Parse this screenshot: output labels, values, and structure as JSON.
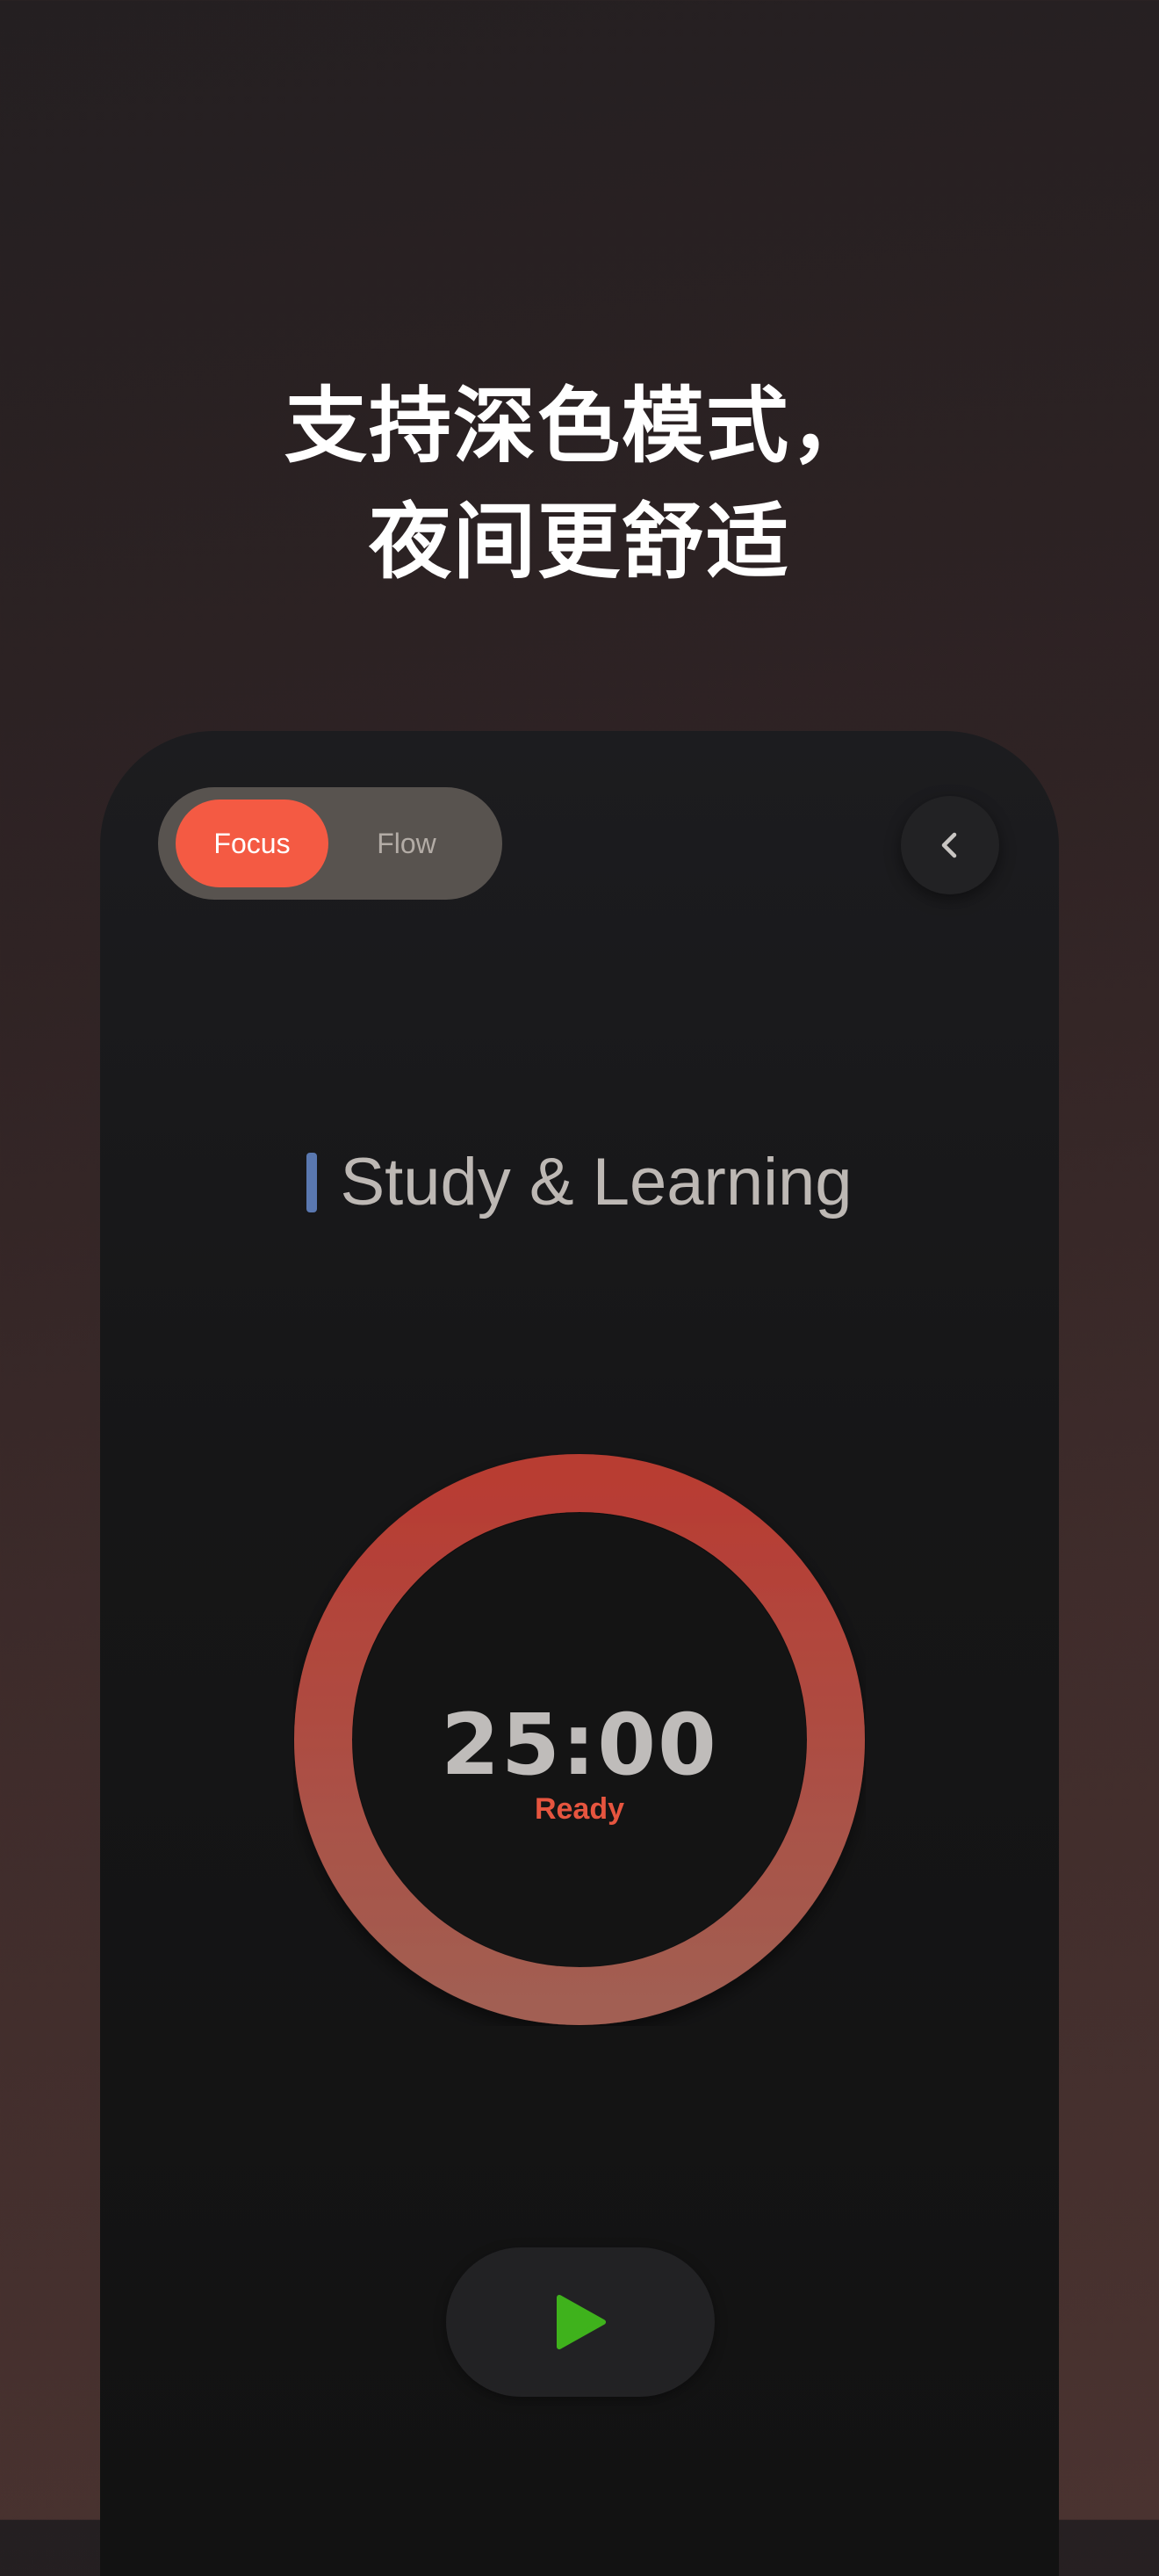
{
  "headline": {
    "line1": "支持深色模式，",
    "line2": "夜间更舒适"
  },
  "mode_toggle": {
    "active_label": "Focus",
    "inactive_label": "Flow"
  },
  "category": {
    "label": "Study & Learning",
    "color": "#5a78b0"
  },
  "timer": {
    "time": "25:00",
    "status": "Ready"
  },
  "colors": {
    "accent": "#f45a43",
    "ring_start": "#b83c33",
    "ring_end": "#a25e52",
    "play": "#3fb21c"
  },
  "icons": {
    "back": "chevron-left-icon",
    "play": "play-icon"
  }
}
